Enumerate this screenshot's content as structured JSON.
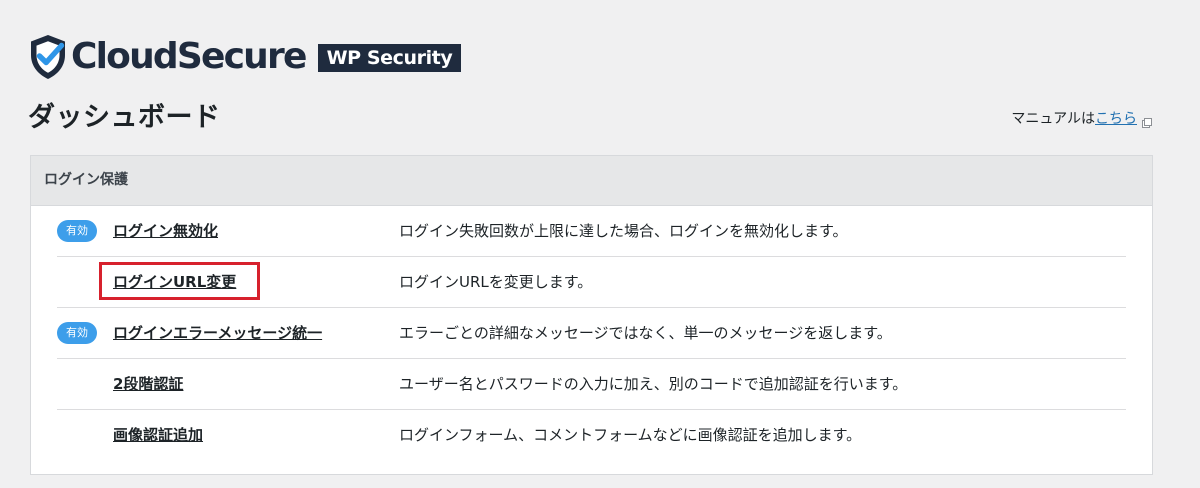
{
  "header": {
    "brand_name": "CloudSecure",
    "brand_badge": "WP Security",
    "logo_icon": "shield-check-icon",
    "brand_color": "#1f2b3e"
  },
  "page": {
    "title": "ダッシュボード",
    "manual_prefix": "マニュアルは",
    "manual_link": "こちら",
    "manual_icon": "external-link-icon"
  },
  "panel": {
    "section_title": "ログイン保護",
    "rows": [
      {
        "badge": "有効",
        "enabled": true,
        "name": "ログイン無効化",
        "description": "ログイン失敗回数が上限に達した場合、ログインを無効化します。"
      },
      {
        "badge": "",
        "enabled": false,
        "name": "ログインURL変更",
        "description": "ログインURLを変更します。",
        "highlighted": true
      },
      {
        "badge": "有効",
        "enabled": true,
        "name": "ログインエラーメッセージ統一",
        "description": "エラーごとの詳細なメッセージではなく、単一のメッセージを返します。"
      },
      {
        "badge": "",
        "enabled": false,
        "name": "2段階認証",
        "description": "ユーザー名とパスワードの入力に加え、別のコードで追加認証を行います。"
      },
      {
        "badge": "",
        "enabled": false,
        "name": "画像認証追加",
        "description": "ログインフォーム、コメントフォームなどに画像認証を追加します。"
      }
    ]
  },
  "colors": {
    "accent_badge": "#3d9eea",
    "link": "#2271b1",
    "highlight": "#d7212d"
  }
}
